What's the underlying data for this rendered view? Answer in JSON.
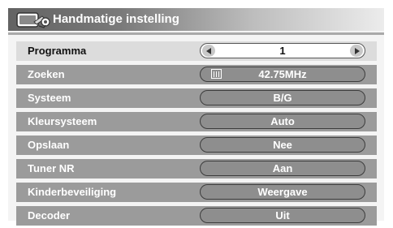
{
  "header": {
    "title": "Handmatige instelling",
    "icon": "tv-settings-icon"
  },
  "colors": {
    "row_background": "#9b9b9b",
    "row_selected_background": "#dcdcdc",
    "pill_background": "#8e8e8e",
    "text_light": "#ffffff",
    "text_dark": "#111111"
  },
  "rows": [
    {
      "label": "Programma",
      "value": "1",
      "selected": true,
      "control": "spinner"
    },
    {
      "label": "Zoeken",
      "value": "42.75MHz",
      "selected": false,
      "control": "search"
    },
    {
      "label": "Systeem",
      "value": "B/G",
      "selected": false,
      "control": "select"
    },
    {
      "label": "Kleursysteem",
      "value": "Auto",
      "selected": false,
      "control": "select"
    },
    {
      "label": "Opslaan",
      "value": "Nee",
      "selected": false,
      "control": "select"
    },
    {
      "label": "Tuner NR",
      "value": "Aan",
      "selected": false,
      "control": "select"
    },
    {
      "label": "Kinderbeveiliging",
      "value": "Weergave",
      "selected": false,
      "control": "select"
    },
    {
      "label": "Decoder",
      "value": "Uit",
      "selected": false,
      "control": "select"
    }
  ]
}
